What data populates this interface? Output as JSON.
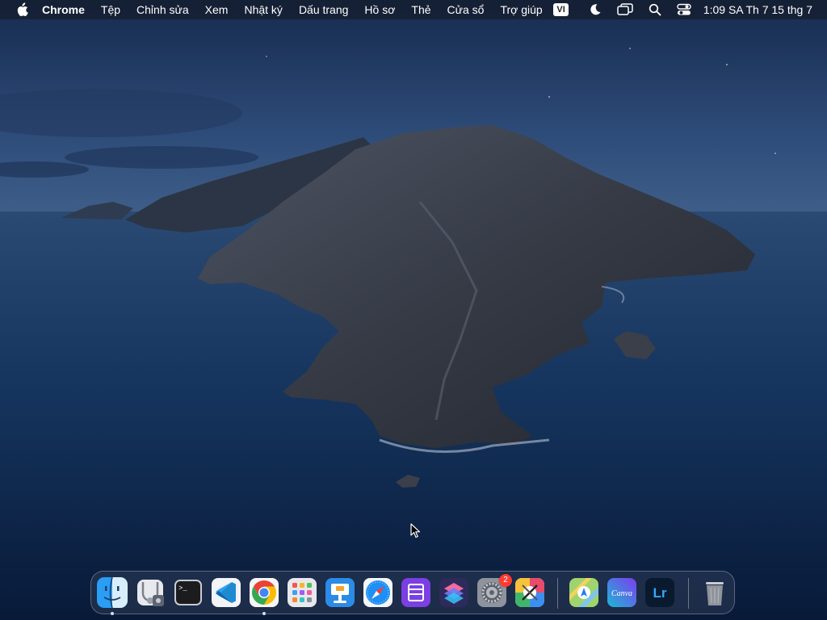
{
  "menubar": {
    "app_name": "Chrome",
    "items": [
      "Tệp",
      "Chỉnh sửa",
      "Xem",
      "Nhật ký",
      "Dấu trang",
      "Hồ sơ",
      "Thẻ",
      "Cửa sổ",
      "Trợ giúp"
    ],
    "input_source": "VI",
    "clock": "1:09 SA Th 7 15 thg 7",
    "icons": [
      "apple-icon",
      "moon-icon",
      "screen-mirroring-icon",
      "search-icon",
      "control-center-icon"
    ]
  },
  "dock": {
    "items": [
      {
        "name": "finder",
        "icon": "finder-icon",
        "running": true
      },
      {
        "name": "disk-utility",
        "icon": "disk-utility-icon",
        "running": false
      },
      {
        "name": "terminal",
        "icon": "terminal-icon",
        "running": false,
        "text": ">_"
      },
      {
        "name": "vscode",
        "icon": "vscode-icon",
        "running": false
      },
      {
        "name": "chrome",
        "icon": "chrome-icon",
        "running": true
      },
      {
        "name": "launchpad",
        "icon": "launchpad-icon",
        "running": false
      },
      {
        "name": "keynote",
        "icon": "keynote-icon",
        "running": false
      },
      {
        "name": "safari",
        "icon": "safari-icon",
        "running": false
      },
      {
        "name": "storage-app",
        "icon": "storage-app-icon",
        "running": false
      },
      {
        "name": "shortcuts",
        "icon": "shortcuts-icon",
        "running": false
      },
      {
        "name": "system-settings",
        "icon": "settings-gear-icon",
        "running": false,
        "badge": "2"
      },
      {
        "name": "developer-tool",
        "icon": "developer-tools-icon",
        "running": false
      },
      {
        "name": "maps",
        "icon": "maps-icon",
        "running": false
      },
      {
        "name": "canva",
        "icon": "canva-icon",
        "running": false,
        "text": "Canva"
      },
      {
        "name": "lightroom",
        "icon": "lightroom-icon",
        "running": false,
        "text": "Lr"
      },
      {
        "name": "trash",
        "icon": "trash-icon",
        "running": false
      }
    ]
  },
  "colors": {
    "sky": "#2a4a78",
    "sea": "#0f2a52",
    "island": "#3a3f4a",
    "chrome_red": "#ea4335",
    "chrome_green": "#34a853",
    "chrome_yellow": "#fbbc05",
    "chrome_blue": "#4285f4"
  }
}
